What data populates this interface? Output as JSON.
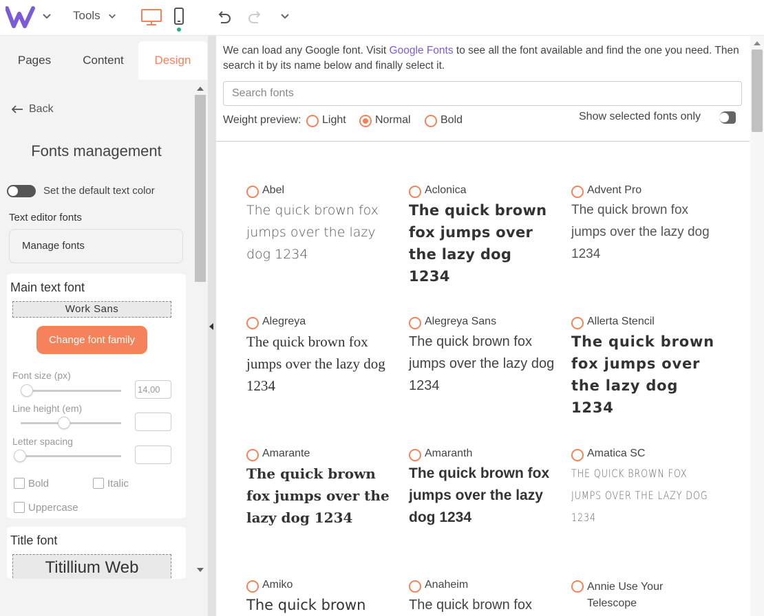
{
  "topbar": {
    "tools_label": "Tools",
    "colors": {
      "accent": "#f5825a",
      "logo": "#7b5bd8",
      "active_dot": "#27b07a"
    }
  },
  "left_panel": {
    "tabs": [
      {
        "label": "Pages"
      },
      {
        "label": "Content"
      },
      {
        "label": "Design",
        "active": true
      }
    ],
    "back_label": "Back",
    "title": "Fonts management",
    "default_text_color_label": "Set the default text color",
    "text_editor_fonts_label": "Text editor fonts",
    "manage_fonts_label": "Manage fonts",
    "main_text_font": {
      "title": "Main text font",
      "font_name": "Work Sans",
      "change_button": "Change font family",
      "font_size_label": "Font size (px)",
      "font_size_value": "14,00",
      "line_height_label": "Line height (em)",
      "line_height_value": "",
      "letter_spacing_label": "Letter spacing",
      "letter_spacing_value": "",
      "bold_label": "Bold",
      "italic_label": "Italic",
      "uppercase_label": "Uppercase"
    },
    "title_font": {
      "title": "Title font",
      "font_name": "Titillium Web"
    }
  },
  "main": {
    "intro_before": "We can load any Google font. Visit ",
    "intro_link": "Google Fonts",
    "intro_after": " to see all the font available and find the one you need. Then search it by its name below and finally select it.",
    "search_placeholder": "Search fonts",
    "weight_preview_label": "Weight preview:",
    "weights": [
      {
        "label": "Light",
        "selected": false
      },
      {
        "label": "Normal",
        "selected": true
      },
      {
        "label": "Bold",
        "selected": false
      }
    ],
    "show_selected_label": "Show selected fonts only",
    "sample_text": "The quick brown fox jumps over the lazy dog 1234",
    "fonts": [
      {
        "name": "Abel",
        "sample": "The quick brown fox jumps over the lazy dog 1234"
      },
      {
        "name": "Aclonica",
        "sample": "The quick brown fox jumps over the lazy dog 1234"
      },
      {
        "name": "Advent Pro",
        "sample": "The quick brown fox jumps over the lazy dog 1234"
      },
      {
        "name": "Alegreya",
        "sample": "The quick brown fox jumps over the lazy dog 1234"
      },
      {
        "name": "Alegreya Sans",
        "sample": "The quick brown fox jumps over the lazy dog 1234"
      },
      {
        "name": "Allerta Stencil",
        "sample": "The quick brown fox jumps over the lazy dog 1234"
      },
      {
        "name": "Amarante",
        "sample": "The quick brown fox jumps over the lazy dog 1234"
      },
      {
        "name": "Amaranth",
        "sample": "The quick brown fox jumps over the lazy dog 1234"
      },
      {
        "name": "Amatica SC",
        "sample": "THE QUICK BROWN FOX JUMPS OVER THE LAZY DOG 1234"
      },
      {
        "name": "Amiko",
        "sample": "The quick brown"
      },
      {
        "name": "Anaheim",
        "sample": "The quick brown fox"
      },
      {
        "name": "Annie Use Your Telescope",
        "sample": ""
      }
    ]
  }
}
